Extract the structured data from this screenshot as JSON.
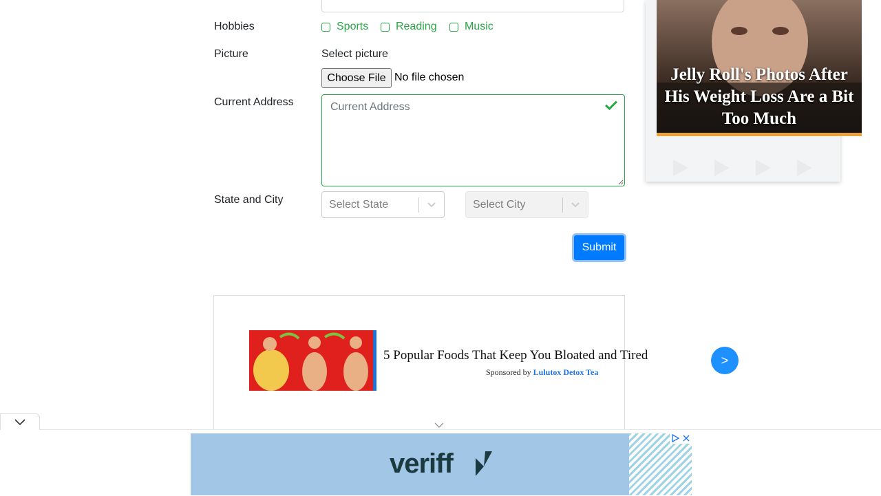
{
  "form": {
    "hobbies_label": "Hobbies",
    "hobbies": [
      {
        "label": "Sports",
        "checked": false
      },
      {
        "label": "Reading",
        "checked": false
      },
      {
        "label": "Music",
        "checked": false
      }
    ],
    "picture_label": "Picture",
    "select_picture_text": "Select picture",
    "choose_file_label": "Choose File",
    "file_status": "No file chosen",
    "address_label": "Current Address",
    "address_placeholder": "Current Address",
    "state_city_label": "State and City",
    "state_placeholder": "Select State",
    "city_placeholder": "Select City",
    "submit_label": "Submit"
  },
  "ads": {
    "inline": {
      "title": "5 Popular Foods That Keep You Bloated and Tired",
      "sponsored_prefix": "Sponsored by",
      "sponsor": "Lulutox Detox Tea",
      "arrow": ">"
    },
    "sidebar": {
      "title": "Jelly Roll's Photos After His Weight Loss Are a Bit Too Much"
    },
    "bottom": {
      "brand": "veriff"
    }
  },
  "colors": {
    "success": "#28a745",
    "primary": "#007bff"
  }
}
